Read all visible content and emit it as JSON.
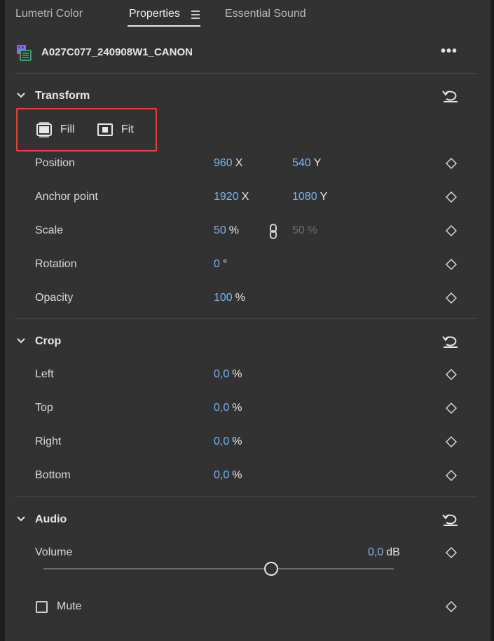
{
  "tabs": {
    "lumetri": "Lumetri Color",
    "properties": "Properties",
    "essential_sound": "Essential Sound"
  },
  "clip": {
    "name": "A027C077_240908W1_CANON",
    "more": "•••"
  },
  "transform": {
    "title": "Transform",
    "fill_label": "Fill",
    "fit_label": "Fit",
    "position": {
      "label": "Position",
      "x": "960",
      "x_unit": "X",
      "y": "540",
      "y_unit": "Y"
    },
    "anchor": {
      "label": "Anchor point",
      "x": "1920",
      "x_unit": "X",
      "y": "1080",
      "y_unit": "Y"
    },
    "scale": {
      "label": "Scale",
      "value": "50",
      "unit": "%",
      "value2": "50",
      "unit2": "%"
    },
    "rotation": {
      "label": "Rotation",
      "value": "0",
      "unit": "°"
    },
    "opacity": {
      "label": "Opacity",
      "value": "100",
      "unit": "%"
    }
  },
  "crop": {
    "title": "Crop",
    "left": {
      "label": "Left",
      "value": "0,0",
      "unit": "%"
    },
    "top": {
      "label": "Top",
      "value": "0,0",
      "unit": "%"
    },
    "right": {
      "label": "Right",
      "value": "0,0",
      "unit": "%"
    },
    "bottom": {
      "label": "Bottom",
      "value": "0,0",
      "unit": "%"
    }
  },
  "audio": {
    "title": "Audio",
    "volume": {
      "label": "Volume",
      "value": "0,0",
      "unit": "dB",
      "slider_fraction": 0.65
    },
    "mute": {
      "label": "Mute",
      "checked": false
    }
  },
  "colors": {
    "accent_value": "#7bb4ee",
    "highlight_box": "#e0453b",
    "panel_bg": "#323232"
  }
}
